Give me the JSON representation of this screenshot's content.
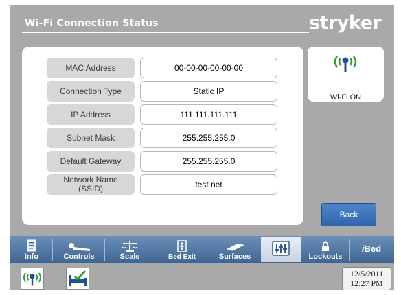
{
  "header": {
    "title": "Wi-Fi Connection Status",
    "brand": "stryker"
  },
  "connection_rows": [
    {
      "label": "MAC Address",
      "value": "00-00-00-00-00-00"
    },
    {
      "label": "Connection Type",
      "value": "Static IP"
    },
    {
      "label": "IP Address",
      "value": "111.111.111.111"
    },
    {
      "label": "Subnet Mask",
      "value": "255.255.255.0"
    },
    {
      "label": "Default Gateway",
      "value": "255.255.255.0"
    },
    {
      "label": "Network Name\n(SSID)",
      "value": "test net"
    }
  ],
  "wifi_card": {
    "status": "Wi-Fi ON",
    "icon": "wifi-signal-icon"
  },
  "back_button": {
    "label": "Back"
  },
  "tabs": [
    {
      "label": "Info",
      "icon": "info-document-icon"
    },
    {
      "label": "Controls",
      "icon": "patient-controls-icon"
    },
    {
      "label": "Scale",
      "icon": "scale-icon"
    },
    {
      "label": "Bed Exit",
      "icon": "bed-exit-icon"
    },
    {
      "label": "Surfaces",
      "icon": "surface-mattress-icon"
    },
    {
      "label": "",
      "icon": "settings-sliders-icon",
      "active": true
    },
    {
      "label": "Lockouts",
      "icon": "lock-icon"
    },
    {
      "label": "Bed",
      "prefix": "i",
      "icon": "ibed-logo"
    }
  ],
  "status_bar": {
    "icons": [
      "wifi-status-icon",
      "bed-status-icon"
    ],
    "date": "12/5/2011",
    "time": "12:27 PM"
  },
  "colors": {
    "screen_bg": "#a9a9a9",
    "tab_bar": "#3e6493",
    "back_button": "#2f66b0",
    "wifi_green": "#2e9d35",
    "wifi_blue": "#1f4f96"
  }
}
